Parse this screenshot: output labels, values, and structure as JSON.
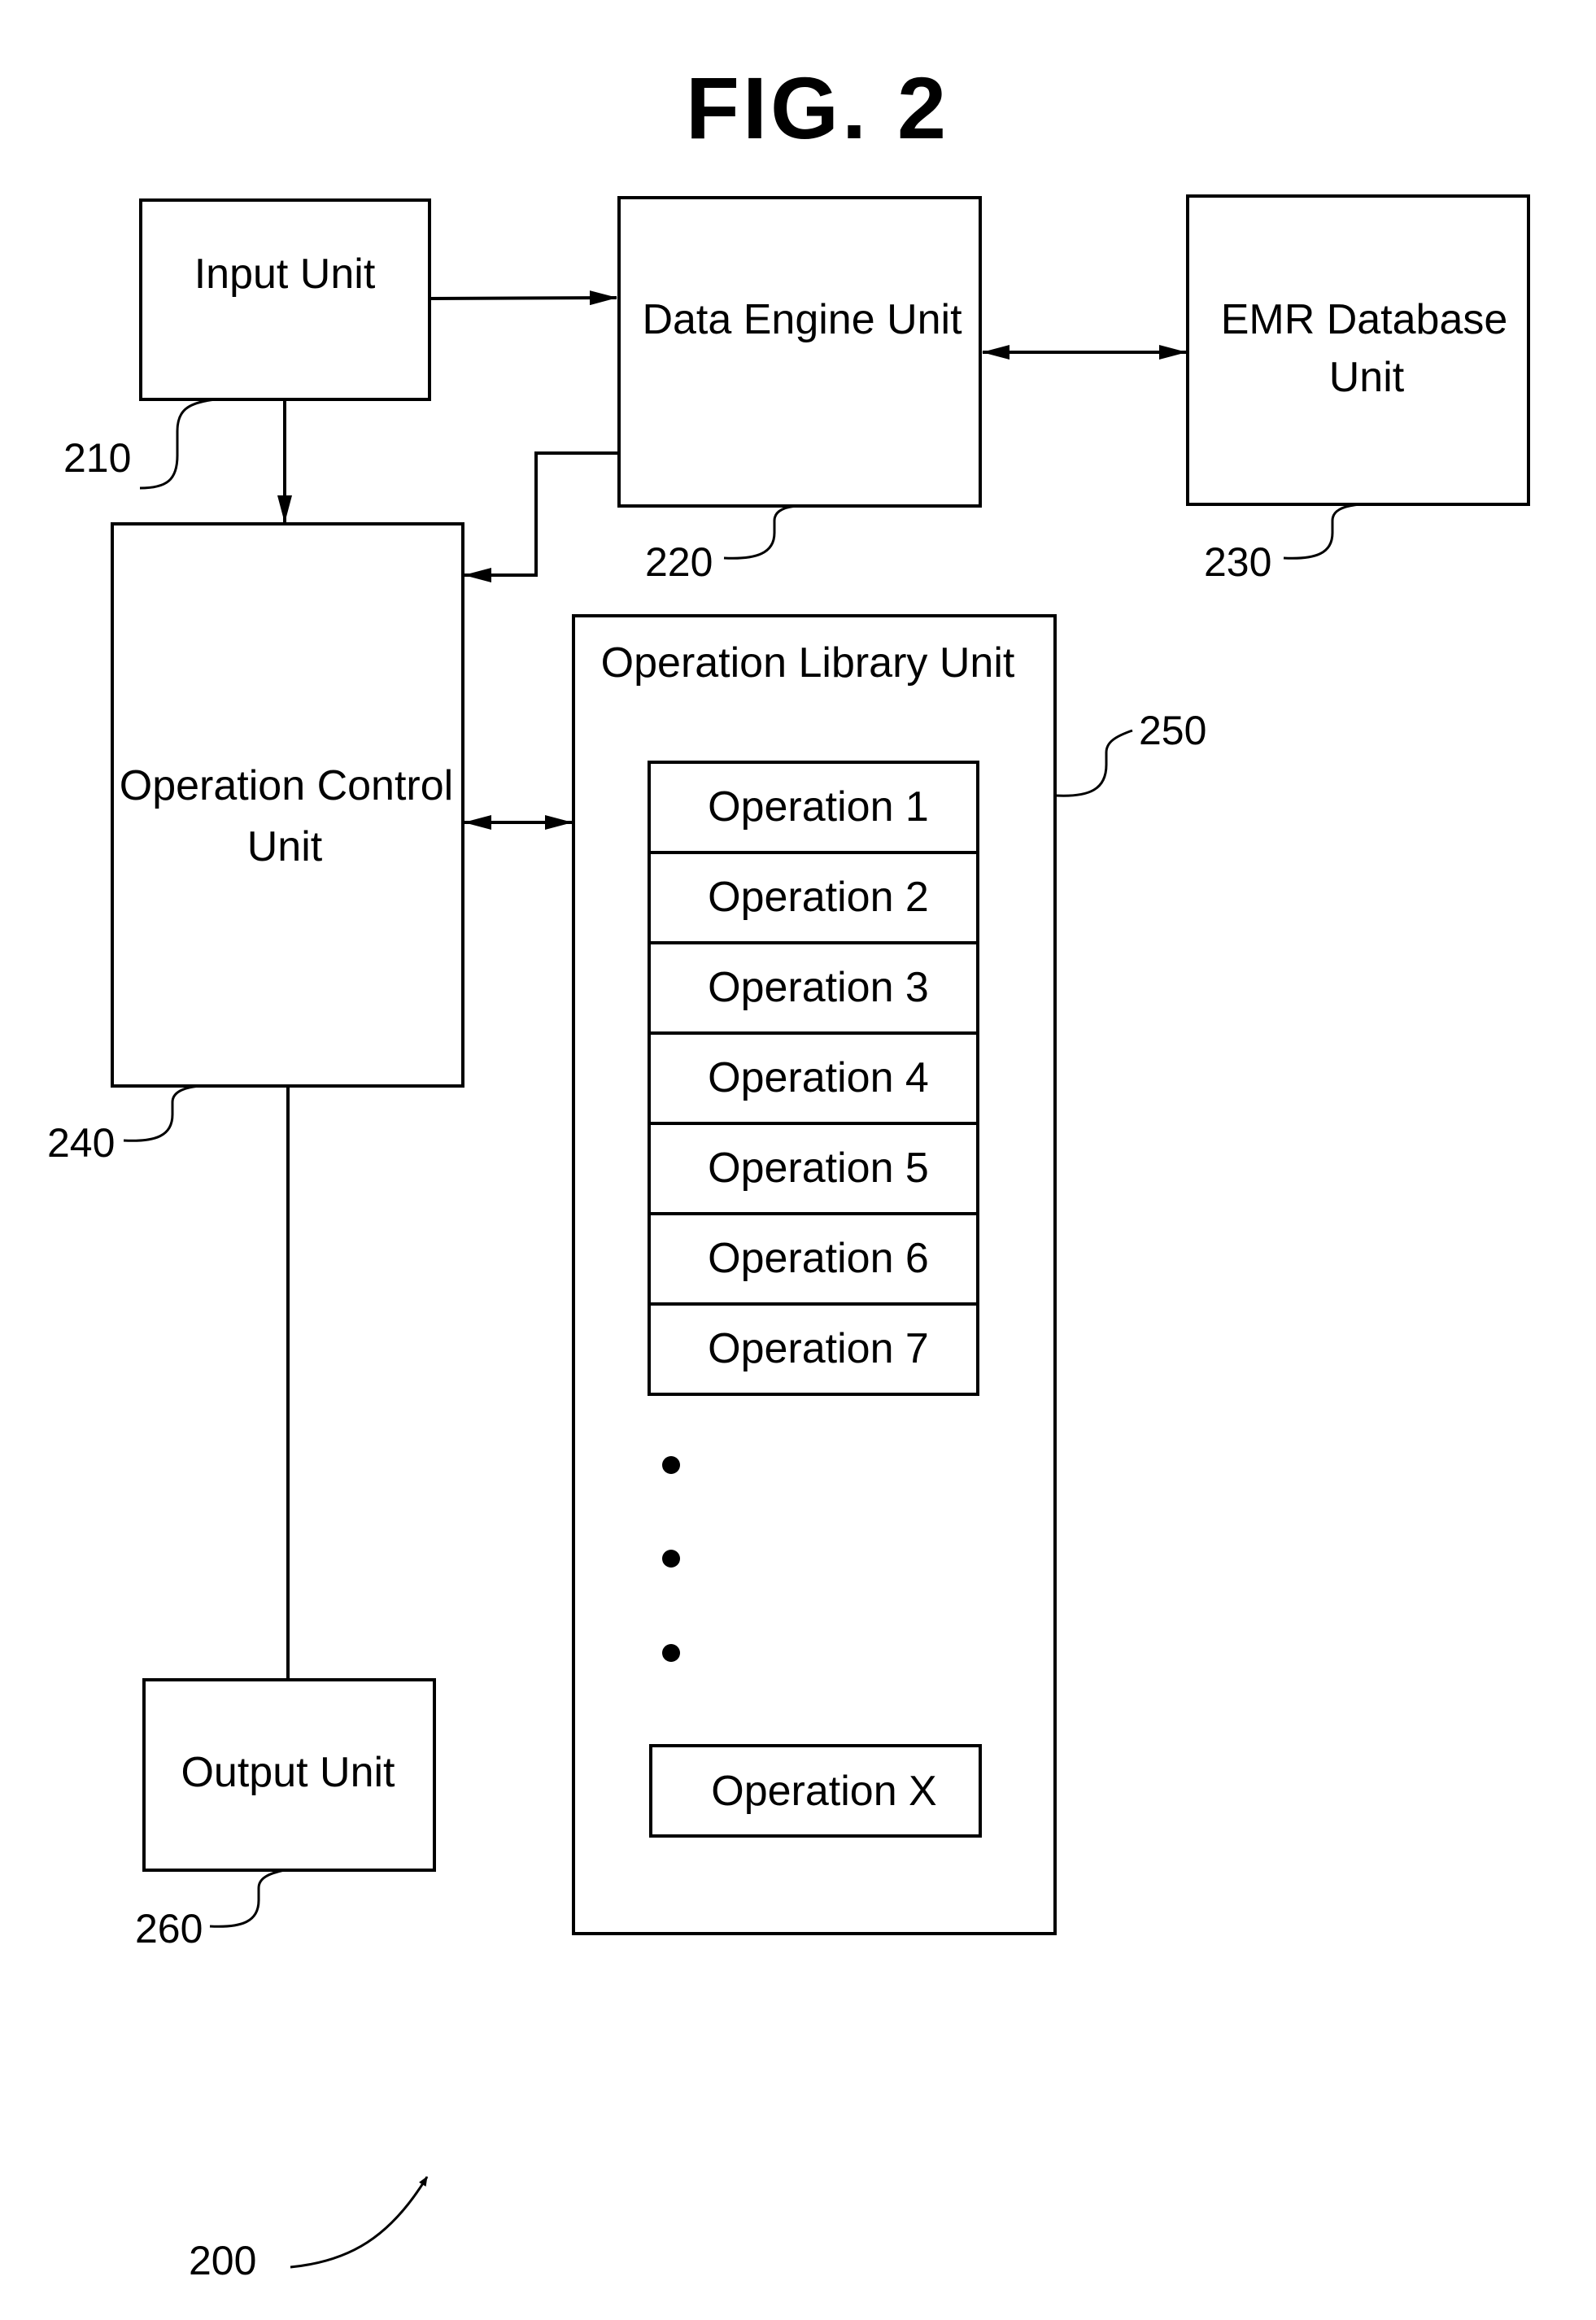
{
  "figure": {
    "title": "FIG. 2",
    "system_ref": "200"
  },
  "blocks": {
    "input": {
      "label": "Input Unit",
      "ref": "210"
    },
    "data_engine": {
      "label": "Data Engine Unit",
      "ref": "220"
    },
    "emr_database": {
      "label_line1": "EMR Database",
      "label_line2": "Unit",
      "ref": "230"
    },
    "operation_control": {
      "label_line1": "Operation Control",
      "label_line2": "Unit",
      "ref": "240"
    },
    "operation_library": {
      "label": "Operation Library Unit",
      "ref": "250"
    },
    "output": {
      "label": "Output Unit",
      "ref": "260"
    }
  },
  "operations": [
    "Operation 1",
    "Operation 2",
    "Operation 3",
    "Operation 4",
    "Operation 5",
    "Operation 6",
    "Operation 7"
  ],
  "operation_last": "Operation X",
  "connections": [
    {
      "from": "Input Unit",
      "to": "Data Engine Unit",
      "direction": "one-way"
    },
    {
      "from": "Input Unit",
      "to": "Operation Control Unit",
      "direction": "one-way"
    },
    {
      "from": "Data Engine Unit",
      "to": "EMR Database Unit",
      "direction": "two-way"
    },
    {
      "from": "Data Engine Unit",
      "to": "Operation Control Unit",
      "direction": "one-way"
    },
    {
      "from": "Operation Control Unit",
      "to": "Operation Library Unit",
      "direction": "two-way"
    },
    {
      "from": "Operation Control Unit",
      "to": "Output Unit",
      "direction": "line"
    }
  ]
}
